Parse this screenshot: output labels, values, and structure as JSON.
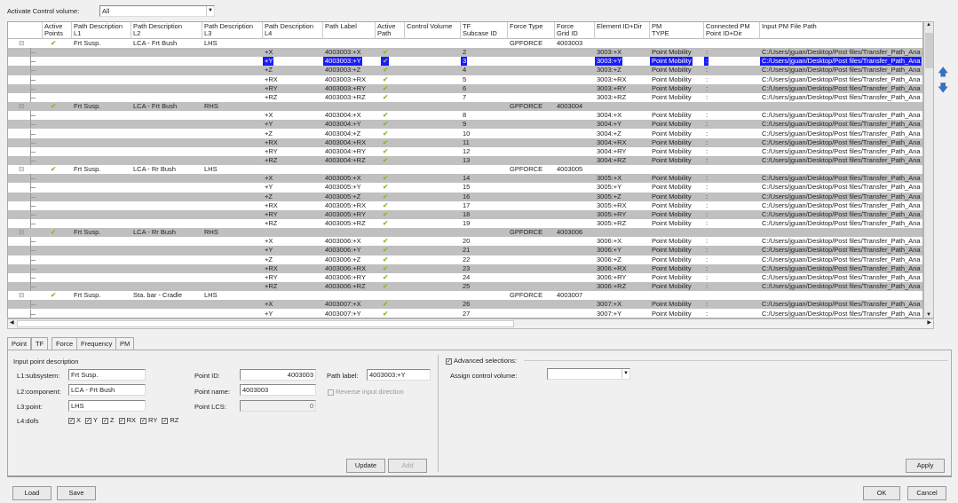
{
  "top": {
    "label": "Activate Control volume:",
    "value": "All"
  },
  "columns": [
    "",
    "Active\nPoints",
    "Path Description\nL1",
    "Path Description\nL2",
    "Path Description\nL3",
    "Path Description\nL4",
    "Path Label",
    "Active\nPath",
    "Control Volume",
    "TF\nSubcase ID",
    "Force Type",
    "Force\nGrid ID",
    "Element ID+Dir",
    "PM\nTYPE",
    "Connected PM\nPoint ID+Dir",
    "Input PM File Path"
  ],
  "groups": [
    {
      "l1": "Frt Susp.",
      "l2": "LCA - Frt Bush",
      "l3": "LHS",
      "force_type": "GPFORCE",
      "grid": "4003003",
      "elem": "3003",
      "start": 2
    },
    {
      "l1": "Frt Susp.",
      "l2": "LCA - Frt Bush",
      "l3": "RHS",
      "force_type": "GPFORCE",
      "grid": "4003004",
      "elem": "3004",
      "start": 8
    },
    {
      "l1": "Frt Susp.",
      "l2": "LCA - Rr Bush",
      "l3": "LHS",
      "force_type": "GPFORCE",
      "grid": "4003005",
      "elem": "3005",
      "start": 14
    },
    {
      "l1": "Frt Susp.",
      "l2": "LCA - Rr Bush",
      "l3": "RHS",
      "force_type": "GPFORCE",
      "grid": "4003006",
      "elem": "3006",
      "start": 20
    },
    {
      "l1": "Frt Susp.",
      "l2": "Sta. bar - Cradle",
      "l3": "LHS",
      "force_type": "GPFORCE",
      "grid": "4003007",
      "elem": "3007",
      "start": 26,
      "visible_children": 2
    }
  ],
  "dofs": [
    "+X",
    "+Y",
    "+Z",
    "+RX",
    "+RY",
    "+RZ"
  ],
  "pm_type": "Point Mobility",
  "connected": ":",
  "pm_path": "C:/Users/jguan/Desktop/Post files/Transfer_Path_Ana",
  "selected_row": "4003003:+Y",
  "tabs": [
    "Point",
    "TF",
    "Force",
    "Frequency",
    "PM"
  ],
  "point": {
    "section": "Input point description",
    "l1_label": "L1:subsystem:",
    "l1": "Frt Susp.",
    "l2_label": "L2:component:",
    "l2": "LCA - Frt Bush",
    "l3_label": "L3:point:",
    "l3": "LHS",
    "l4_label": "L4:dofs",
    "dofs": [
      "X",
      "Y",
      "Z",
      "RX",
      "RY",
      "RZ"
    ],
    "pid_label": "Point ID:",
    "pid": "4003003",
    "pname_label": "Point name:",
    "pname": "4003003",
    "lcs_label": "Point LCS:",
    "lcs": "0",
    "plabel_label": "Path label:",
    "plabel": "4003003:+Y",
    "reverse": "Reverse input direction",
    "update": "Update",
    "add": "Add"
  },
  "advanced": {
    "title": "Advanced selections:",
    "assign_label": "Assign control volume:",
    "assign_value": "",
    "apply": "Apply"
  },
  "footer": {
    "load": "Load",
    "save": "Save",
    "ok": "OK",
    "cancel": "Cancel"
  },
  "colors": {
    "selection": "#1a1aff",
    "alt_row": "#c0c0c0",
    "check": "#8ab82a"
  }
}
